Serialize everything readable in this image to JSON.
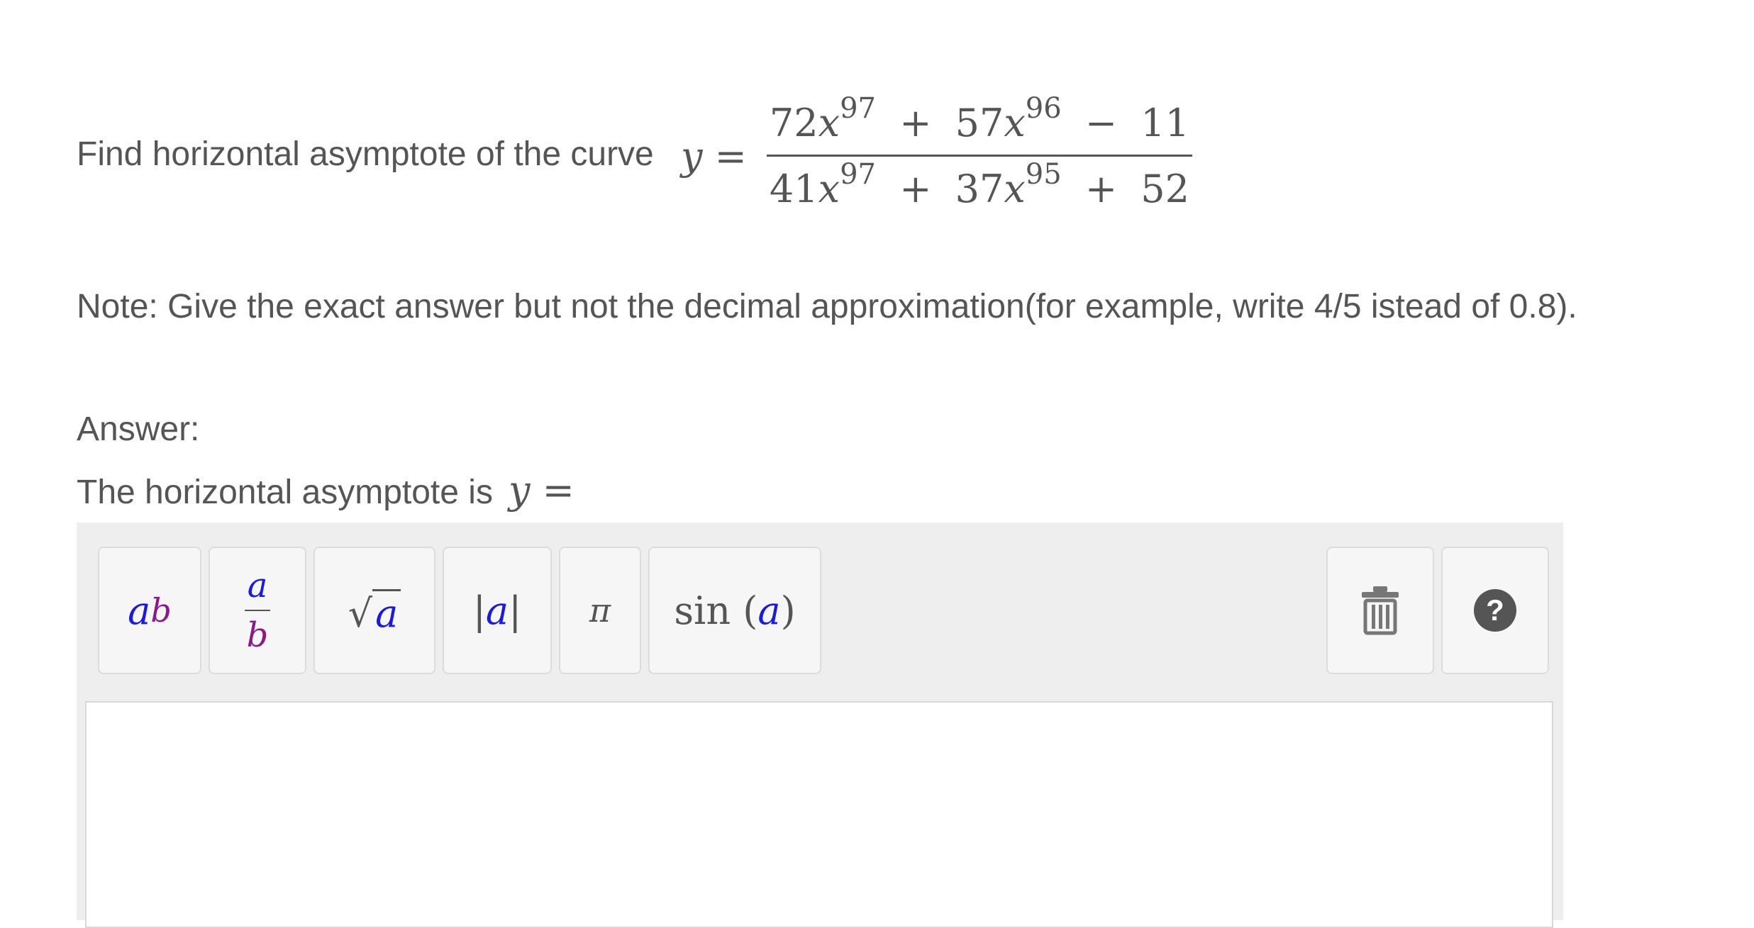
{
  "question": {
    "prompt": "Find horizontal asymptote of the curve",
    "lhs": "y =",
    "numerator": {
      "t1_coef": "72",
      "t1_var": "x",
      "t1_exp": "97",
      "op1": "+",
      "t2_coef": "57",
      "t2_var": "x",
      "t2_exp": "96",
      "op2": "−",
      "t3": "11"
    },
    "denominator": {
      "t1_coef": "41",
      "t1_var": "x",
      "t1_exp": "97",
      "op1": "+",
      "t2_coef": "37",
      "t2_var": "x",
      "t2_exp": "95",
      "op2": "+",
      "t3": "52"
    }
  },
  "note": "Note: Give the exact answer but not the decimal approximation(for example, write 4/5 istead of 0.8).",
  "answer": {
    "label": "Answer:",
    "sentence": "The horizontal asymptote is",
    "lhs": "y ="
  },
  "toolbar": {
    "power": {
      "base": "a",
      "exp": "b"
    },
    "fraction": {
      "num": "a",
      "den": "b"
    },
    "sqrt": {
      "symbol": "√",
      "arg": "a"
    },
    "abs": {
      "left": "|",
      "arg": "a",
      "right": "|"
    },
    "pi": {
      "symbol": "π"
    },
    "sin": {
      "fn": "sin",
      "open": "(",
      "arg": "a",
      "close": ")"
    },
    "help": {
      "symbol": "?"
    }
  },
  "icons": {
    "trash": "trash-icon",
    "help": "help-icon"
  },
  "colors": {
    "variable_blue": "#1a1ae0",
    "variable_purple": "#8a1a8a",
    "text": "#555555",
    "toolbar_bg": "#eeeeee"
  }
}
